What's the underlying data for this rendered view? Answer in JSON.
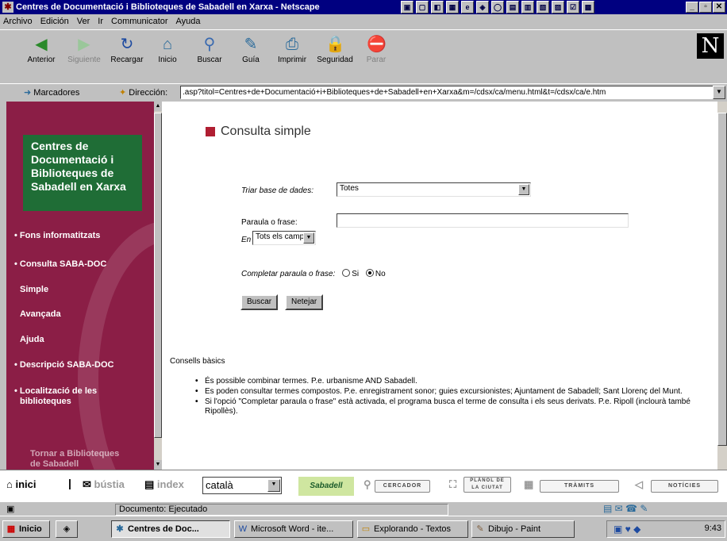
{
  "window": {
    "title": "Centres de Documentació i Biblioteques de Sabadell en Xarxa - Netscape"
  },
  "menu": [
    "Archivo",
    "Edición",
    "Ver",
    "Ir",
    "Communicator",
    "Ayuda"
  ],
  "toolbar": [
    {
      "label": "Anterior",
      "icon": "back-arrow-icon",
      "enabled": true
    },
    {
      "label": "Siguiente",
      "icon": "forward-arrow-icon",
      "enabled": false
    },
    {
      "label": "Recargar",
      "icon": "reload-icon",
      "enabled": true
    },
    {
      "label": "Inicio",
      "icon": "home-icon",
      "enabled": true
    },
    {
      "label": "Buscar",
      "icon": "search-icon",
      "enabled": true
    },
    {
      "label": "Guía",
      "icon": "guide-icon",
      "enabled": true
    },
    {
      "label": "Imprimir",
      "icon": "print-icon",
      "enabled": true
    },
    {
      "label": "Seguridad",
      "icon": "security-icon",
      "enabled": true
    },
    {
      "label": "Parar",
      "icon": "stop-icon",
      "enabled": false
    }
  ],
  "brand": "N",
  "location": {
    "bookmarks_label": "Marcadores",
    "direction_label": "Dirección:",
    "url": ".asp?titol=Centres+de+Documentació+i+Biblioteques+de+Sabadell+en+Xarxa&m=/cdsx/ca/menu.html&t=/cdsx/ca/e.htm"
  },
  "sidebar": {
    "title": "Centres de Documentació i Biblioteques de Sabadell en Xarxa",
    "items": [
      {
        "label": "• Fons informatitzats",
        "sub": false
      },
      {
        "label": "• Consulta SABA-DOC",
        "sub": false
      },
      {
        "label": "Simple",
        "sub": true
      },
      {
        "label": "Avançada",
        "sub": true
      },
      {
        "label": "Ajuda",
        "sub": true
      },
      {
        "label": "• Descripció SABA-DOC",
        "sub": false
      },
      {
        "label": "• Localització de les",
        "sub": false
      },
      {
        "label": "biblioteques",
        "sub": false
      },
      {
        "label": "Tornar a Biblioteques",
        "sub": true
      },
      {
        "label": "de Sabadell",
        "sub": true
      }
    ]
  },
  "form": {
    "title": "Consulta simple",
    "db_label": "Triar base de dades:",
    "db_value": "Totes",
    "query_label": "Paraula o frase:",
    "query_value": "",
    "in_label": "En",
    "in_value": "Tots els camps",
    "complete_label": "Completar paraula o frase:",
    "yes_label": "Si",
    "no_label": "No",
    "complete_selected": "No",
    "search_button": "Buscar",
    "clear_button": "Netejar"
  },
  "tips": {
    "heading": "Consells bàsics",
    "items": [
      "És possible combinar termes. P.e. urbanisme AND Sabadell.",
      "Es poden consultar termes compostos. P.e. enregistrament sonor; guies excursionistes; Ajuntament de Sabadell; Sant Llorenç del Munt.",
      "Si l'opció \"Completar paraula o frase\" està activada, el programa busca el terme de consulta i els seus derivats. P.e. Ripoll (inclourà també Ripollès)."
    ]
  },
  "navbar": {
    "inici": "inici",
    "bustia": "bústia",
    "index": "index",
    "language": "català",
    "sabadell": "Sabadell",
    "cercador": "CERCADOR",
    "planol_1": "PLÀNOL DE",
    "planol_2": "LA CIUTAT",
    "tramits": "TRÀMITS",
    "noticies": "NOTÍCIES"
  },
  "status": {
    "text": "Documento: Ejecutado"
  },
  "taskbar": {
    "start": "Inicio",
    "tasks": [
      {
        "label": "Centres de Doc...",
        "active": true
      },
      {
        "label": "Microsoft Word - ite...",
        "active": false
      },
      {
        "label": "Explorando - Textos",
        "active": false
      },
      {
        "label": "Dibujo - Paint",
        "active": false
      }
    ],
    "clock": "9:43"
  },
  "colors": {
    "sidebar": "#8b1e46",
    "sidebar_box": "#1f6d36",
    "title_square": "#b01e32",
    "titlebar": "#000080"
  }
}
